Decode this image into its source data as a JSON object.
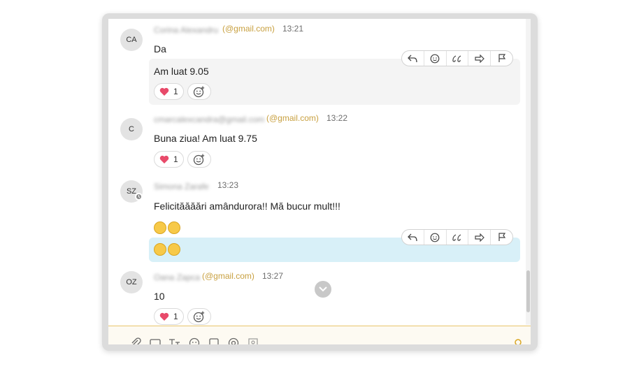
{
  "colors": {
    "email_accent": "#c8a040",
    "highlight_blue": "#d8f0f8",
    "highlight_gray": "#f4f4f4",
    "composer_border": "#e8c56b"
  },
  "messages": [
    {
      "initials": "CA",
      "sender": "Corina Alexandru",
      "email": "(@gmail.com)",
      "time": "13:21",
      "lines": [
        "Da",
        "Am luat 9.05"
      ],
      "reaction_emoji": "heart",
      "reaction_count": "1"
    },
    {
      "initials": "C",
      "sender": "cmarcalexcandra@gmail.com",
      "email": "(@gmail.com)",
      "time": "13:22",
      "lines": [
        "Buna ziua! Am luat 9.75"
      ],
      "reaction_emoji": "heart",
      "reaction_count": "1"
    },
    {
      "initials": "SZ",
      "sender": "Simona Zarafe",
      "time": "13:23",
      "lines": [
        "Felicităăăări amândurora!! Mă bucur mult!!!"
      ],
      "status_icon": "clock-icon"
    },
    {
      "initials": "OZ",
      "sender": "Oana Zapca",
      "email": "(@gmail.com)",
      "time": "13:27",
      "lines": [
        "10"
      ],
      "reaction_emoji": "heart",
      "reaction_count": "1"
    }
  ],
  "hover_toolbar": [
    "reply-icon",
    "react-icon",
    "quote-icon",
    "forward-icon",
    "flag-icon"
  ],
  "composer_icons": [
    "attach-icon",
    "gif-icon",
    "text-format-icon",
    "emoji-icon",
    "file-icon",
    "mention-icon",
    "contact-icon",
    "send-icon"
  ]
}
